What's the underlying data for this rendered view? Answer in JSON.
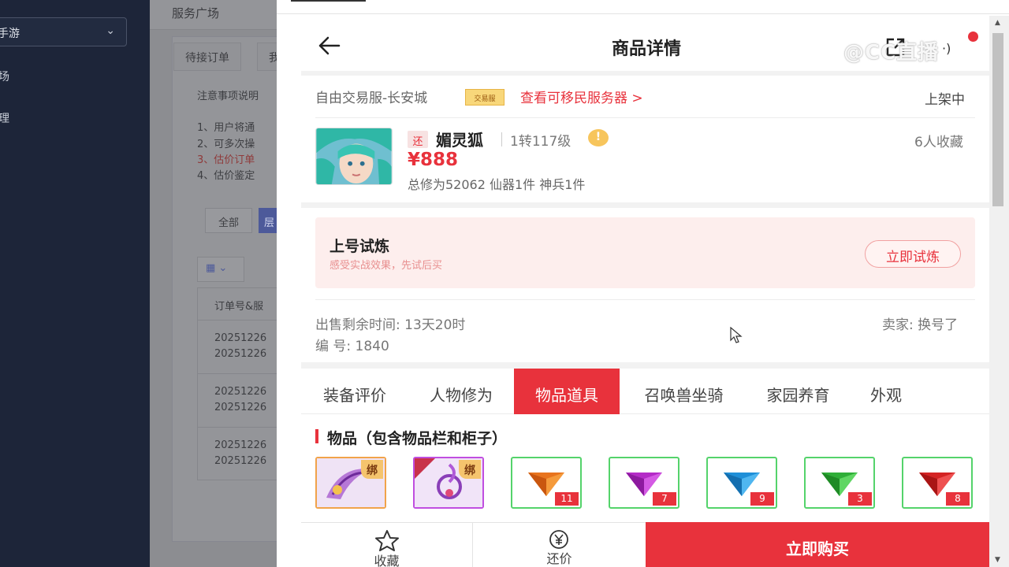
{
  "background_app": {
    "game_select": "手游",
    "nav_items": [
      "场",
      "理"
    ],
    "header_title": "服务广场",
    "tabs": [
      "待接订单",
      "我"
    ],
    "notice_title": "注意事项说明",
    "notice_lines": [
      "1、用户将通",
      "2、可多次操",
      "3、估价订单",
      "4、估价鉴定"
    ],
    "filter_all": "全部",
    "filter_second": "层",
    "table_header": "订单号&服",
    "order_rows": [
      [
        "20251226",
        "20251226"
      ],
      [
        "20251226",
        "20251226"
      ],
      [
        "20251226",
        "20251226"
      ]
    ]
  },
  "phone": {
    "nav": {
      "title": "商品详情",
      "watermark": "@CC直播",
      "more_label": "·)"
    },
    "server": {
      "name": "自由交易服-长安城",
      "tag": "交易服",
      "migrate_link": "查看可移民服务器 >",
      "status": "上架中"
    },
    "role": {
      "badge": "还",
      "name": "媚灵狐",
      "level": "1转117级",
      "favorites": "6人收藏",
      "price": "¥888",
      "summary": "总修为52062  仙器1件  神兵1件"
    },
    "trial": {
      "title": "上号试炼",
      "subtitle": "感受实战效果，先试后买",
      "button": "立即试炼"
    },
    "info": {
      "remaining": "出售剩余时间: 13天20时",
      "seller": "卖家: 换号了",
      "serial": "编 号: 1840"
    },
    "tabs": [
      "装备评价",
      "人物修为",
      "物品道具",
      "召唤兽坐骑",
      "家园养育",
      "外观"
    ],
    "active_tab": "物品道具",
    "section_title": "物品（包含物品栏和柜子）",
    "items": [
      {
        "type": "orange",
        "bind": "绑",
        "count": ""
      },
      {
        "type": "purple",
        "bind": "绑",
        "count": ""
      },
      {
        "type": "green",
        "gem": "orange",
        "bind": "",
        "count": "11"
      },
      {
        "type": "green",
        "gem": "purple",
        "bind": "",
        "count": "7"
      },
      {
        "type": "green",
        "gem": "blue",
        "bind": "",
        "count": "9"
      },
      {
        "type": "green",
        "gem": "green",
        "bind": "",
        "count": "3"
      },
      {
        "type": "green",
        "gem": "red",
        "bind": "",
        "count": "8"
      }
    ],
    "bottom": {
      "favorite": "收藏",
      "bargain": "还价",
      "buy": "立即购买"
    },
    "colors": {
      "accent": "#e8323c",
      "trial_bg": "#fdeeed"
    }
  }
}
